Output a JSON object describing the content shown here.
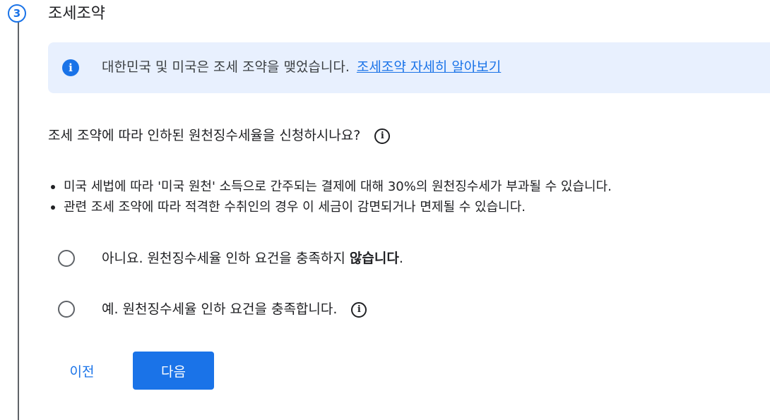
{
  "step": {
    "number": "3",
    "title": "조세조약"
  },
  "info": {
    "icon": "info-icon",
    "text": "대한민국 및 미국은 조세 조약을 맺었습니다.",
    "link": "조세조약 자세히 알아보기"
  },
  "question": {
    "text": "조세 조약에 따라 인하된 원천징수세율을 신청하시나요?",
    "help_icon": "i"
  },
  "bullets": [
    "미국 세법에 따라 '미국 원천' 소득으로 간주되는 결제에 대해 30%의 원천징수세가 부과될 수 있습니다.",
    "관련 조세 조약에 따라 적격한 수취인의 경우 이 세금이 감면되거나 면제될 수 있습니다."
  ],
  "options": {
    "no": {
      "prefix": "아니요. 원천징수세율 인하 요건을 충족하지 ",
      "bold": "않습니다",
      "suffix": "."
    },
    "yes": {
      "label": "예. 원천징수세율 인하 요건을 충족합니다.",
      "help_icon": "i"
    }
  },
  "buttons": {
    "prev": "이전",
    "next": "다음"
  },
  "colors": {
    "accent": "#1a73e8",
    "info_bg": "#e8f0fe"
  }
}
